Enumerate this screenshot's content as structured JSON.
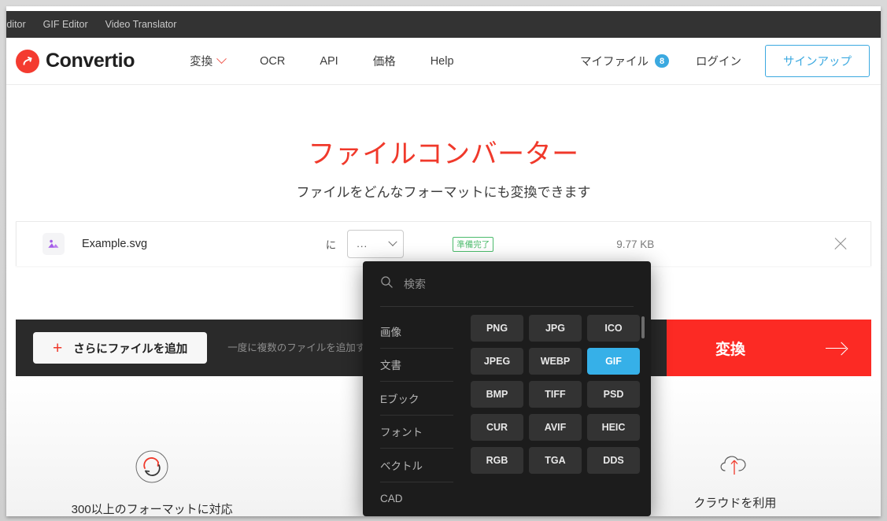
{
  "topbar": {
    "links": [
      {
        "label": "Editor"
      },
      {
        "label": "GIF Editor"
      },
      {
        "label": "Video Translator"
      }
    ]
  },
  "header": {
    "logo_text": "Convertio",
    "logo_icon": "convertio-logo-icon",
    "nav": [
      {
        "label": "変換",
        "has_caret": true
      },
      {
        "label": "OCR",
        "has_caret": false
      },
      {
        "label": "API",
        "has_caret": false
      },
      {
        "label": "価格",
        "has_caret": false
      },
      {
        "label": "Help",
        "has_caret": false
      }
    ],
    "my_files_label": "マイファイル",
    "my_files_count": "8",
    "login_label": "ログイン",
    "signup_label": "サインアップ",
    "accent_blue": "#3ba9e0"
  },
  "hero": {
    "title": "ファイルコンバーター",
    "subtitle": "ファイルをどんなフォーマットにも変換できます",
    "title_color": "#f0392b"
  },
  "file_row": {
    "file_icon": "image-file-icon",
    "file_name": "Example.svg",
    "to_label": "に",
    "format_value": "...",
    "chevron_icon": "chevron-down-icon",
    "status": "準備完了",
    "status_color": "#4cbb6c",
    "size": "9.77 KB",
    "close_icon": "close-icon"
  },
  "action_bar": {
    "add_files_label": "さらにファイルを追加",
    "plus_icon": "plus-icon",
    "hint": "一度に複数のファイルを追加す してください",
    "convert_label": "変換",
    "arrow_icon": "arrow-right-icon",
    "convert_color": "#fc2a24"
  },
  "features": [
    {
      "icon": "convert-circle-icon",
      "label": "300以上のフォーマットに対応"
    },
    {
      "icon": "shield-icon",
      "label": ""
    },
    {
      "icon": "cloud-upload-icon",
      "label": "クラウドを利用"
    }
  ],
  "dropdown": {
    "search_placeholder": "検索",
    "search_value": "",
    "search_icon": "search-icon",
    "categories": [
      {
        "label": "画像"
      },
      {
        "label": "文書"
      },
      {
        "label": "Eブック"
      },
      {
        "label": "フォント"
      },
      {
        "label": "ベクトル"
      },
      {
        "label": "CAD"
      }
    ],
    "formats": [
      {
        "label": "PNG",
        "selected": false
      },
      {
        "label": "JPG",
        "selected": false
      },
      {
        "label": "ICO",
        "selected": false
      },
      {
        "label": "JPEG",
        "selected": false
      },
      {
        "label": "WEBP",
        "selected": false
      },
      {
        "label": "GIF",
        "selected": true
      },
      {
        "label": "BMP",
        "selected": false
      },
      {
        "label": "TIFF",
        "selected": false
      },
      {
        "label": "PSD",
        "selected": false
      },
      {
        "label": "CUR",
        "selected": false
      },
      {
        "label": "AVIF",
        "selected": false
      },
      {
        "label": "HEIC",
        "selected": false
      },
      {
        "label": "RGB",
        "selected": false
      },
      {
        "label": "TGA",
        "selected": false
      },
      {
        "label": "DDS",
        "selected": false
      }
    ],
    "selected_color": "#36b0e8"
  }
}
